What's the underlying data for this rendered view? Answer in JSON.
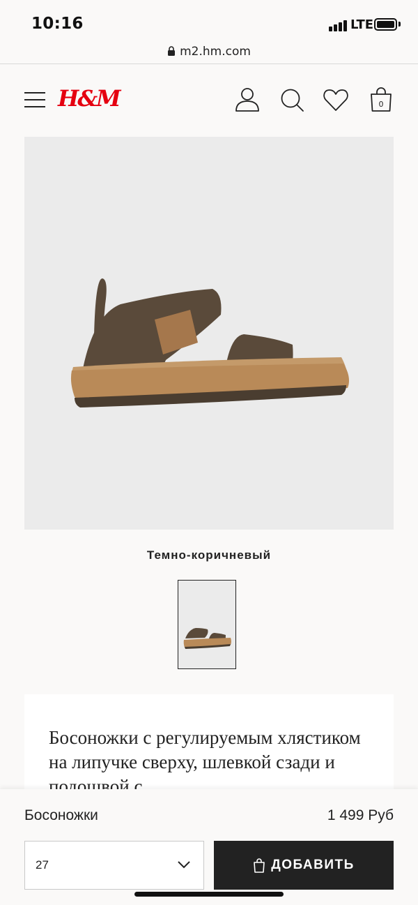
{
  "status_bar": {
    "time": "10:16",
    "network": "LTE"
  },
  "browser": {
    "url": "m2.hm.com"
  },
  "header": {
    "logo": "H&M",
    "icons": [
      "menu-icon",
      "account-icon",
      "search-icon",
      "favorites-icon",
      "bag-icon"
    ],
    "bag_count": "0",
    "brand_color": "#e50010"
  },
  "product": {
    "color_name": "Темно-коричневый",
    "description": "Босоножки с регулируемым хлястиком на липучке сверху, шлевкой сзади и подошвой с",
    "name": "Босоножки",
    "price": "1 499 Руб"
  },
  "buy_bar": {
    "selected_size": "27",
    "add_label": "ДОБАВИТЬ"
  }
}
